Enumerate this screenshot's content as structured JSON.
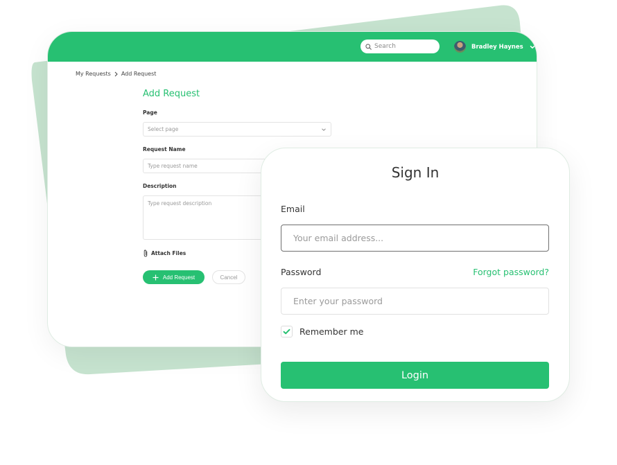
{
  "colors": {
    "accent": "#27c072",
    "accent_light": "#c6e3cf"
  },
  "app": {
    "header": {
      "search": {
        "placeholder": "Search",
        "icon": "search-icon"
      },
      "user": {
        "name": "Bradley Haynes",
        "avatar": "avatar",
        "menu_icon": "chevron-down-icon"
      }
    },
    "breadcrumb": {
      "items": [
        "My Requests",
        "Add Request"
      ],
      "separator_icon": "chevron-right-icon"
    },
    "form": {
      "title": "Add Request",
      "page": {
        "label": "Page",
        "placeholder": "Select page",
        "value": ""
      },
      "request_name": {
        "label": "Request Name",
        "placeholder": "Type request name",
        "value": ""
      },
      "description": {
        "label": "Description",
        "placeholder": "Type request description",
        "value": ""
      },
      "attach": {
        "label": "Attach Files",
        "icon": "paperclip-icon"
      },
      "submit_label": "Add Request",
      "cancel_label": "Cancel"
    }
  },
  "signin": {
    "title": "Sign In",
    "email": {
      "label": "Email",
      "placeholder": "Your email address...",
      "value": ""
    },
    "password": {
      "label": "Password",
      "placeholder": "Enter your password",
      "value": ""
    },
    "forgot_label": "Forgot password?",
    "remember": {
      "label": "Remember me",
      "checked": true
    },
    "login_label": "Login"
  }
}
